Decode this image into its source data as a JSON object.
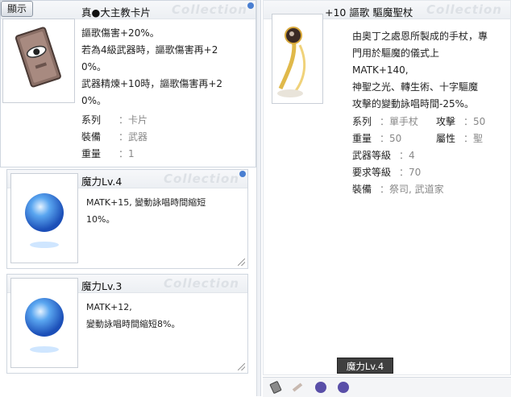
{
  "left_card": {
    "show_button": "顯示",
    "title": "真●大主教卡片",
    "watermark": "Collection",
    "desc_lines": [
      "謳歌傷害+20%。",
      "若為4級武器時，謳歌傷害再+2",
      "0%。",
      "武器精煉+10時，謳歌傷害再+2",
      "0%。"
    ],
    "props": [
      {
        "key": "系列",
        "value": "卡片"
      },
      {
        "key": "裝備",
        "value": "武器"
      },
      {
        "key": "重量",
        "value": "1"
      }
    ]
  },
  "orb_card_1": {
    "title": "魔力Lv.4",
    "watermark": "Collection",
    "desc_lines": [
      "MATK+15, 變動詠唱時間縮短",
      "10%。"
    ]
  },
  "orb_card_2": {
    "title": "魔力Lv.3",
    "watermark": "Collection",
    "desc_lines": [
      "MATK+12,",
      "變動詠唱時間縮短8%。"
    ]
  },
  "right_card": {
    "title": "+10 謳歌 驅魔聖杖",
    "watermark": "Collection",
    "desc_lines": [
      "由奧丁之處恩所製成的手杖，專",
      "門用於驅魔的儀式上",
      "MATK+140,",
      "神聖之光、轉生術、十字驅魔",
      "攻擊的變動詠唱時間-25%。"
    ],
    "props": {
      "row1": {
        "k1": "系列",
        "v1": "單手杖",
        "k2": "攻擊",
        "v2": "50"
      },
      "row2": {
        "k1": "重量",
        "v1": "50",
        "k2": "屬性",
        "v2": "聖"
      },
      "row3": {
        "k1": "武器等級",
        "v1": "4"
      },
      "row4": {
        "k1": "要求等級",
        "v1": "70"
      },
      "row5": {
        "k1": "裝備",
        "v1": "祭司, 武道家"
      }
    }
  },
  "tooltip": "魔力Lv.4",
  "colors": {
    "accent": "#4a7fd1",
    "gray_text": "#888888",
    "tooltip_bg": "#3f3f3f"
  }
}
